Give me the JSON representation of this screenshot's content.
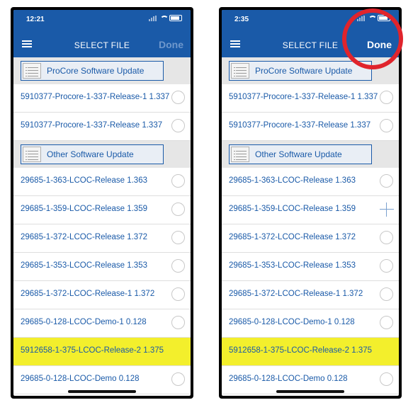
{
  "colors": {
    "brand_blue": "#1a5aa8",
    "highlight": "#f3ef2c",
    "annotation_ring": "#e0242c"
  },
  "screens": [
    {
      "time": "12:21",
      "title": "SELECT FILE",
      "done_label": "Done",
      "done_state": "disabled",
      "section1": "ProCore Software Update",
      "procore_rows": [
        "5910377-Procore-1-337-Release-1 1.337",
        "5910377-Procore-1-337-Release 1.337"
      ],
      "section2": "Other Software Update",
      "other_rows": [
        "29685-1-363-LCOC-Release 1.363",
        "29685-1-359-LCOC-Release 1.359",
        "29685-1-372-LCOC-Release 1.372",
        "29685-1-353-LCOC-Release 1.353",
        "29685-1-372-LCOC-Release-1 1.372",
        "29685-0-128-LCOC-Demo-1 0.128",
        "5912658-1-375-LCOC-Release-2 1.375",
        "29685-0-128-LCOC-Demo 0.128"
      ],
      "highlighted_row": "5912658-1-375-LCOC-Release-2 1.375"
    },
    {
      "time": "2:35",
      "title": "SELECT FILE",
      "done_label": "Done",
      "done_state": "enabled",
      "section1": "ProCore Software Update",
      "procore_rows": [
        "5910377-Procore-1-337-Release-1 1.337",
        "5910377-Procore-1-337-Release 1.337"
      ],
      "section2": "Other Software Update",
      "other_rows": [
        "29685-1-363-LCOC-Release 1.363",
        "29685-1-359-LCOC-Release 1.359",
        "29685-1-372-LCOC-Release 1.372",
        "29685-1-353-LCOC-Release 1.353",
        "29685-1-372-LCOC-Release-1 1.372",
        "29685-0-128-LCOC-Demo-1 0.128",
        "5912658-1-375-LCOC-Release-2 1.375",
        "29685-0-128-LCOC-Demo 0.128"
      ],
      "highlighted_row": "5912658-1-375-LCOC-Release-2 1.375",
      "plus_marker_row": "29685-1-359-LCOC-Release 1.359"
    }
  ]
}
